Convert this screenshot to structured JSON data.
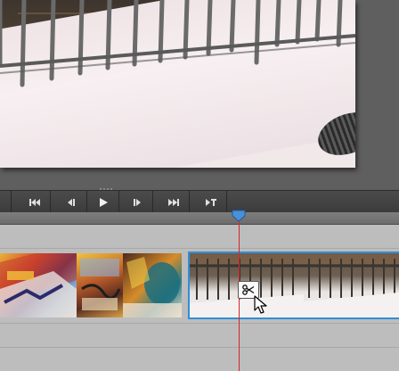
{
  "transport": {
    "buttons": [
      {
        "name": "step-back-button",
        "icon": "step-back-icon"
      },
      {
        "name": "go-to-start-button",
        "icon": "go-to-start-icon"
      },
      {
        "name": "previous-frame-button",
        "icon": "previous-frame-icon"
      },
      {
        "name": "play-button",
        "icon": "play-icon"
      },
      {
        "name": "next-frame-button",
        "icon": "next-frame-icon"
      },
      {
        "name": "go-to-end-button",
        "icon": "go-to-end-icon"
      },
      {
        "name": "mark-button",
        "icon": "mark-icon"
      }
    ]
  },
  "timeline": {
    "clips": [
      {
        "name": "graffiti-clip",
        "icon": "video-thumbnail",
        "selected": false
      },
      {
        "name": "fence-snow-clip",
        "icon": "video-thumbnail",
        "selected": true
      }
    ],
    "tool_tooltip_icon": "scissors-icon",
    "cursor_icon": "arrow-cursor-icon"
  },
  "colors": {
    "selection": "#2f8fd8",
    "playhead": "#d6262a",
    "playhead_handle": "#4a90d9",
    "track_bg": "#bdbdbd",
    "panel_bg": "#5f5f5f"
  }
}
